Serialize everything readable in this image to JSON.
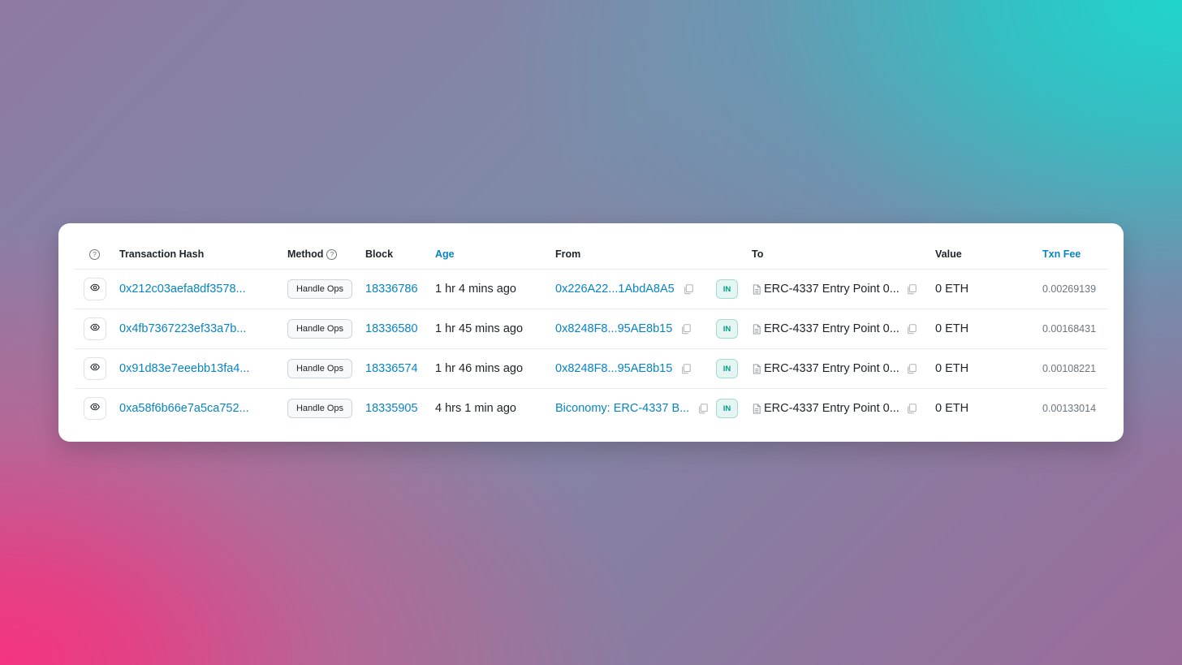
{
  "header": {
    "tx_hash": "Transaction Hash",
    "method": "Method",
    "block": "Block",
    "age": "Age",
    "from": "From",
    "to": "To",
    "value": "Value",
    "txn_fee": "Txn Fee"
  },
  "rows": [
    {
      "hash": "0x212c03aefa8df3578...",
      "method": "Handle Ops",
      "block": "18336786",
      "age": "1 hr 4 mins ago",
      "from": "0x226A22...1AbdA8A5",
      "direction": "IN",
      "to": "ERC-4337 Entry Point 0...",
      "value": "0 ETH",
      "fee": "0.00269139"
    },
    {
      "hash": "0x4fb7367223ef33a7b...",
      "method": "Handle Ops",
      "block": "18336580",
      "age": "1 hr 45 mins ago",
      "from": "0x8248F8...95AE8b15",
      "direction": "IN",
      "to": "ERC-4337 Entry Point 0...",
      "value": "0 ETH",
      "fee": "0.00168431"
    },
    {
      "hash": "0x91d83e7eeebb13fa4...",
      "method": "Handle Ops",
      "block": "18336574",
      "age": "1 hr 46 mins ago",
      "from": "0x8248F8...95AE8b15",
      "direction": "IN",
      "to": "ERC-4337 Entry Point 0...",
      "value": "0 ETH",
      "fee": "0.00108221"
    },
    {
      "hash": "0xa58f6b66e7a5ca752...",
      "method": "Handle Ops",
      "block": "18335905",
      "age": "4 hrs 1 min ago",
      "from": "Biconomy: ERC-4337 B...",
      "direction": "IN",
      "to": "ERC-4337 Entry Point 0...",
      "value": "0 ETH",
      "fee": "0.00133014"
    }
  ],
  "icons": {
    "help": "question-circle-icon",
    "view": "eye-icon",
    "copy": "copy-icon",
    "contract": "document-icon"
  },
  "colors": {
    "link": "#0784c3",
    "in_badge": "#00a186"
  }
}
